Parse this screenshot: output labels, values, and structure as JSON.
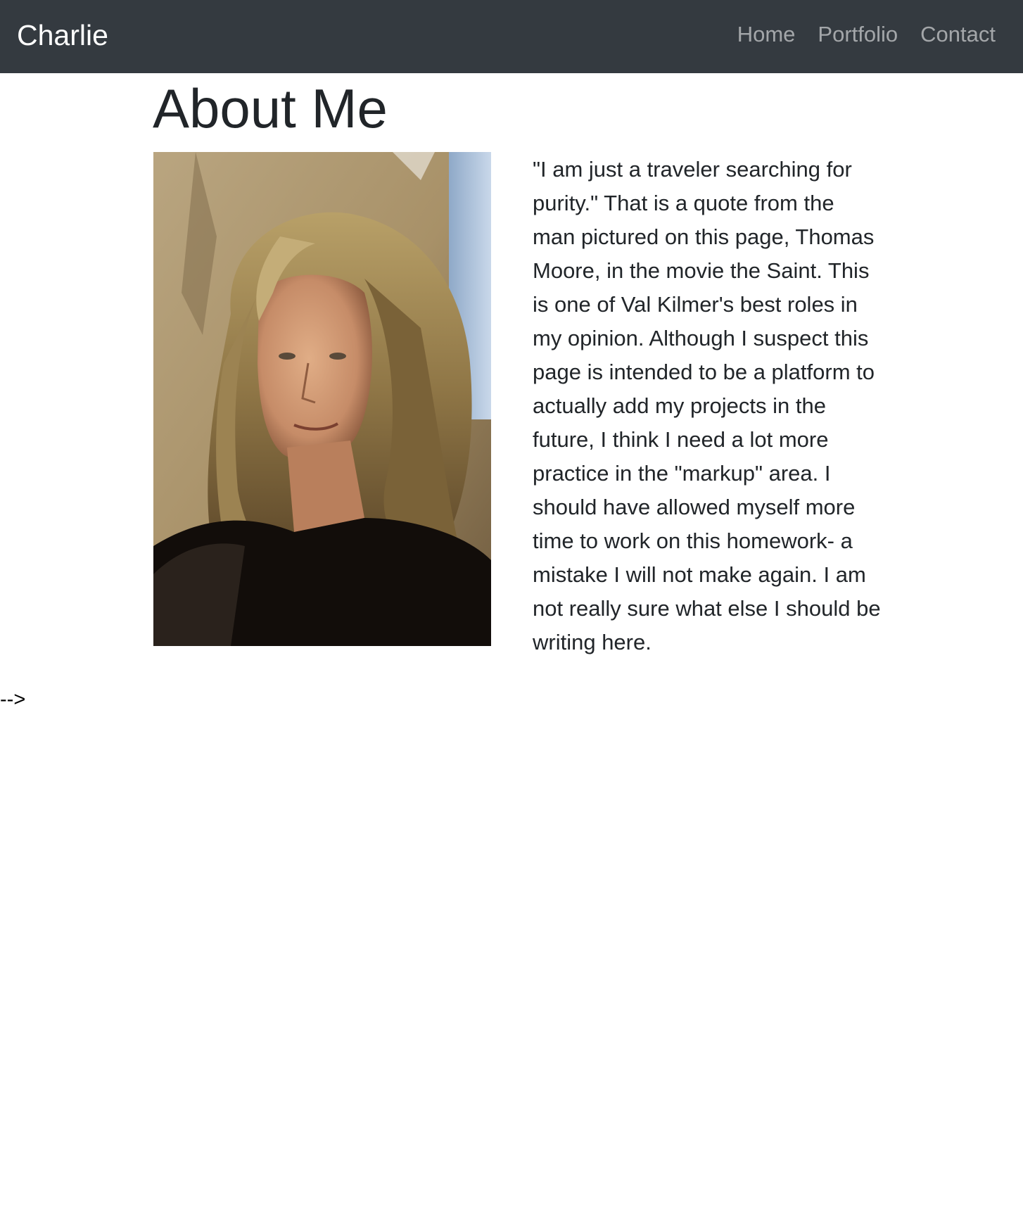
{
  "navbar": {
    "brand": "Charlie",
    "links": [
      {
        "label": "Home"
      },
      {
        "label": "Portfolio"
      },
      {
        "label": "Contact"
      }
    ],
    "background_color": "#343a40",
    "link_color": "rgba(255,255,255,0.55)"
  },
  "main": {
    "title": "About Me",
    "bio": "\"I am just a traveler searching for purity.\" That is a quote from the man pictured on this page, Thomas Moore, in the movie the Saint. This is one of Val Kilmer's best roles in my opinion. Although I suspect this page is intended to be a platform to actually add my projects in the future, I think I need a lot more practice in the \"markup\" area. I should have allowed myself more time to work on this homework- a mistake I will not make again. I am not really sure what else I should be writing here."
  },
  "stray_text": "-->"
}
